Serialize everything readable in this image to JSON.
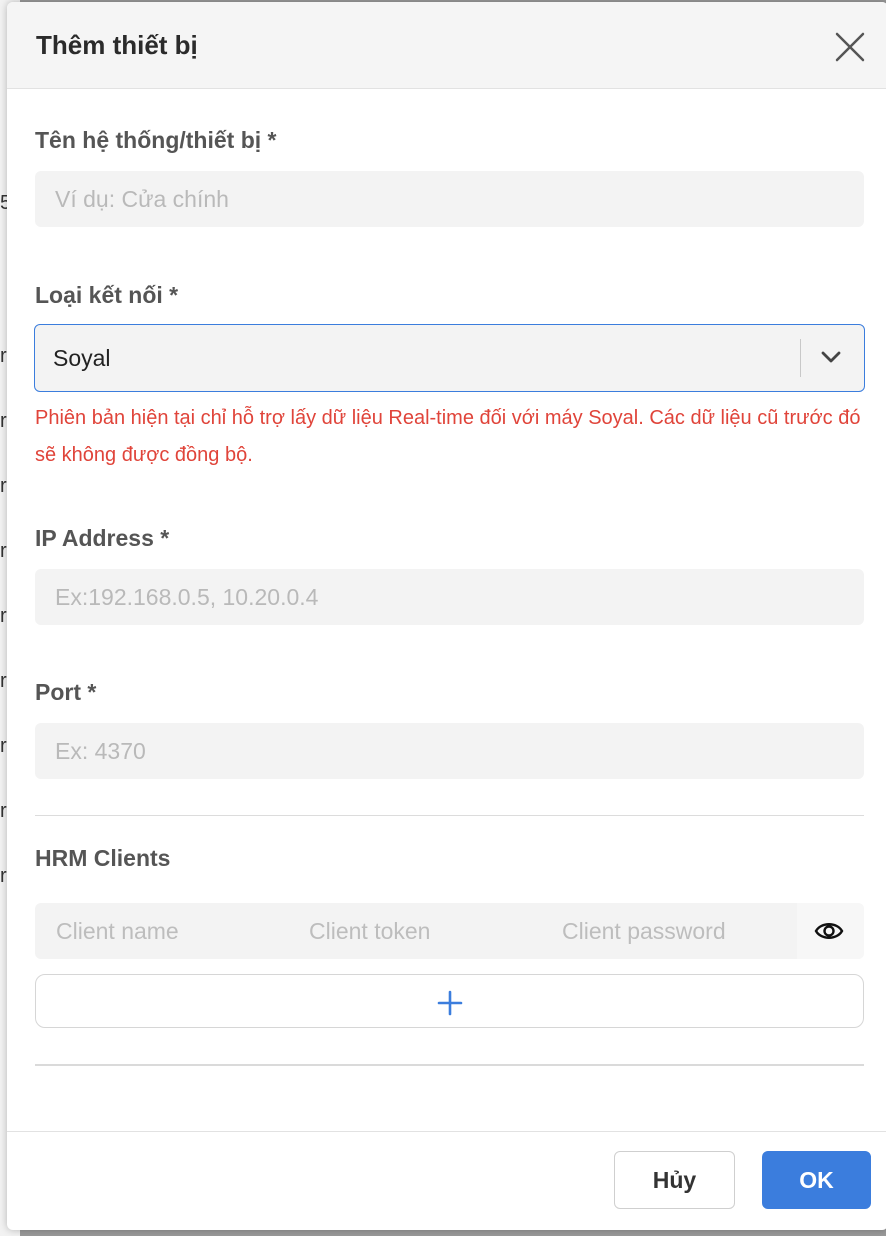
{
  "background": {
    "fragments": [
      "5",
      "r",
      "r",
      "r",
      "r",
      "r",
      "r",
      "r",
      "r",
      "r"
    ]
  },
  "dialog": {
    "title": "Thêm thiết bị",
    "close_icon": "close-icon"
  },
  "form": {
    "device_name": {
      "label": "Tên hệ thống/thiết bị *",
      "value": "",
      "placeholder": "Ví dụ: Cửa chính"
    },
    "connection_type": {
      "label": "Loại kết nối *",
      "selected": "Soyal",
      "dropdown_icon": "chevron-down-icon"
    },
    "warning": "Phiên bản hiện tại chỉ hỗ trợ lấy dữ liệu Real-time đối với máy Soyal. Các dữ liệu cũ trước đó sẽ không được đồng bộ.",
    "ip_address": {
      "label": "IP Address *",
      "value": "",
      "placeholder": "Ex:192.168.0.5, 10.20.0.4"
    },
    "port": {
      "label": "Port *",
      "value": "",
      "placeholder": "Ex: 4370"
    },
    "hrm_clients": {
      "label": "HRM Clients",
      "client_name_placeholder": "Client name",
      "client_token_placeholder": "Client token",
      "client_password_placeholder": "Client password",
      "show_password_icon": "eye-icon",
      "add_icon": "plus-icon"
    }
  },
  "footer": {
    "cancel_label": "Hủy",
    "ok_label": "OK"
  },
  "colors": {
    "accent": "#3b7ddd",
    "warning": "#e0443a",
    "input_bg": "#f3f3f3"
  }
}
